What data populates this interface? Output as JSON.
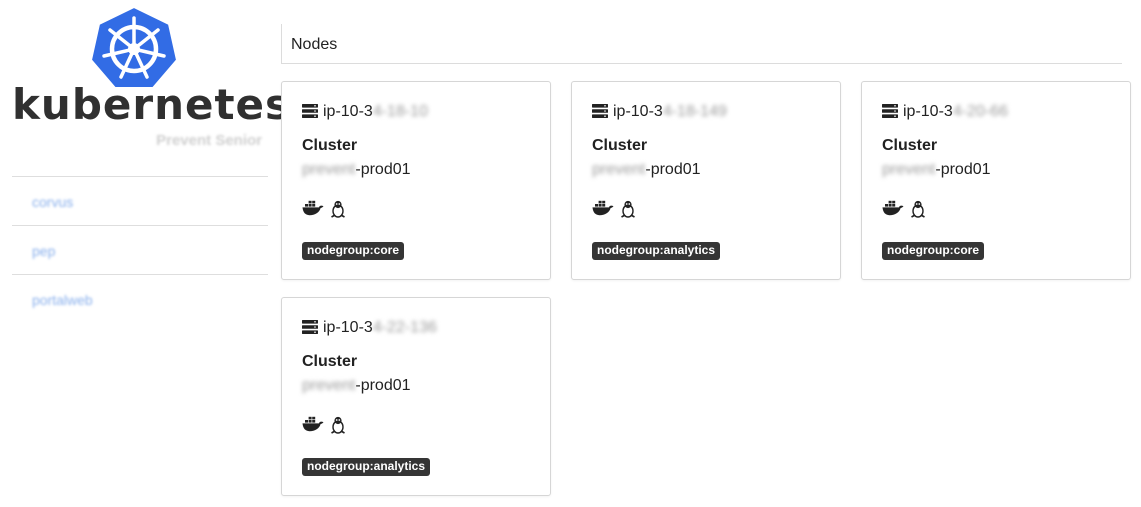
{
  "sidebar": {
    "logo_text": "kubernetes",
    "logo_subtitle": "Prevent Senior",
    "logo_color": "#326ce5",
    "nav_items": [
      {
        "label": "corvus"
      },
      {
        "label": "pep"
      },
      {
        "label": "portalweb"
      }
    ]
  },
  "main": {
    "title": "Nodes",
    "nodes": [
      {
        "name_prefix": "ip-10-3",
        "name_hidden": "4-18-10",
        "cluster_label": "Cluster",
        "env_hidden": "prevent",
        "env_suffix": "-prod01",
        "icons": [
          "docker-icon",
          "linux-icon"
        ],
        "label": "nodegroup:core"
      },
      {
        "name_prefix": "ip-10-3",
        "name_hidden": "4-18-149",
        "cluster_label": "Cluster",
        "env_hidden": "prevent",
        "env_suffix": "-prod01",
        "icons": [
          "docker-icon",
          "linux-icon"
        ],
        "label": "nodegroup:analytics"
      },
      {
        "name_prefix": "ip-10-3",
        "name_hidden": "4-20-66",
        "cluster_label": "Cluster",
        "env_hidden": "prevent",
        "env_suffix": "-prod01",
        "icons": [
          "docker-icon",
          "linux-icon"
        ],
        "label": "nodegroup:core"
      },
      {
        "name_prefix": "ip-10-3",
        "name_hidden": "4-22-136",
        "cluster_label": "Cluster",
        "env_hidden": "prevent",
        "env_suffix": "-prod01",
        "icons": [
          "docker-icon",
          "linux-icon"
        ],
        "label": "nodegroup:analytics"
      }
    ]
  }
}
